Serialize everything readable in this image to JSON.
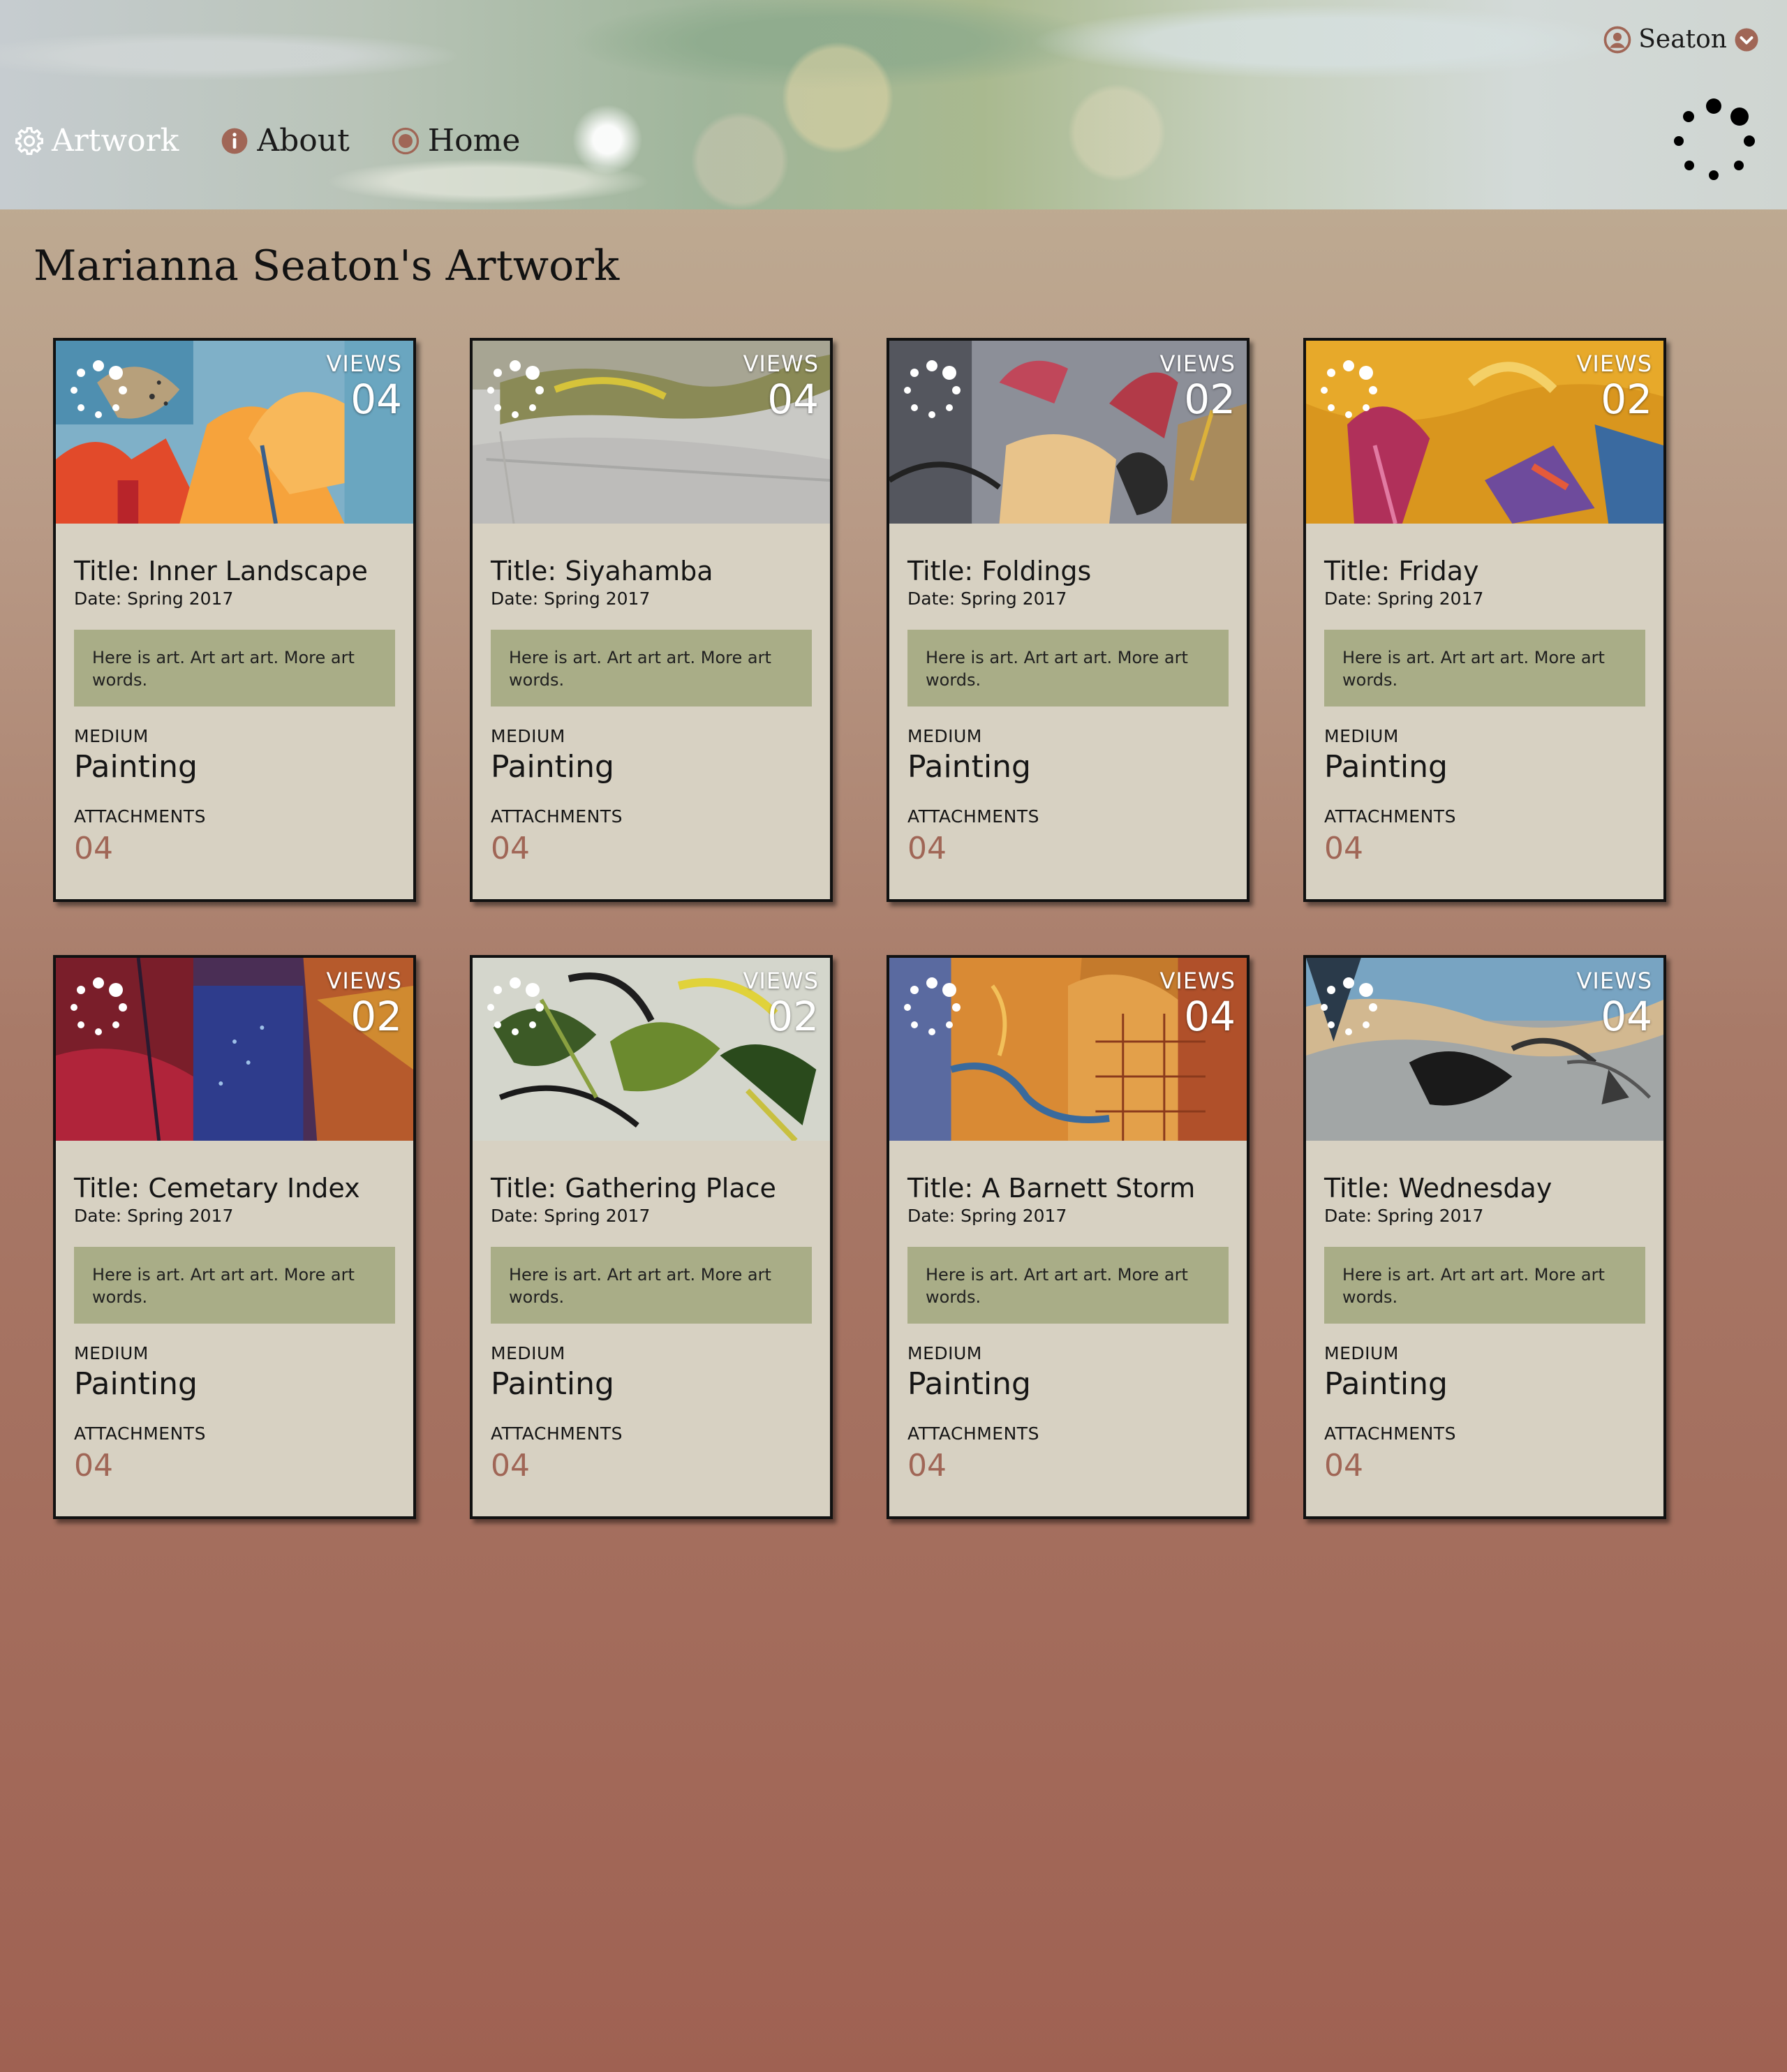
{
  "header": {
    "nav": [
      {
        "label": "Artwork",
        "icon": "gear-icon",
        "active": true
      },
      {
        "label": "About",
        "icon": "info-icon",
        "active": false
      },
      {
        "label": "Home",
        "icon": "record-icon",
        "active": false
      }
    ],
    "user": {
      "name": "Seaton",
      "icon": "user-circle-icon",
      "chevron": "chevron-down-circle-icon"
    }
  },
  "page_title": "Marianna Seaton's Artwork",
  "colors": {
    "accent": "#a06656",
    "description_bg": "#a9ad87",
    "card_bg": "#d7d1c2"
  },
  "cards": [
    {
      "views_label": "VIEWS",
      "views": "04",
      "title": "Title: Inner Landscape",
      "date": "Date: Spring 2017",
      "description": "Here is art. Art art art. More art words.",
      "medium_label": "MEDIUM",
      "medium": "Painting",
      "attachments_label": "ATTACHMENTS",
      "attachments": "04"
    },
    {
      "views_label": "VIEWS",
      "views": "04",
      "title": "Title: Siyahamba",
      "date": "Date: Spring 2017",
      "description": "Here is art. Art art art. More art words.",
      "medium_label": "MEDIUM",
      "medium": "Painting",
      "attachments_label": "ATTACHMENTS",
      "attachments": "04"
    },
    {
      "views_label": "VIEWS",
      "views": "02",
      "title": "Title: Foldings",
      "date": "Date: Spring 2017",
      "description": "Here is art. Art art art. More art words.",
      "medium_label": "MEDIUM",
      "medium": "Painting",
      "attachments_label": "ATTACHMENTS",
      "attachments": "04"
    },
    {
      "views_label": "VIEWS",
      "views": "02",
      "title": "Title: Friday",
      "date": "Date: Spring 2017",
      "description": "Here is art. Art art art. More art words.",
      "medium_label": "MEDIUM",
      "medium": "Painting",
      "attachments_label": "ATTACHMENTS",
      "attachments": "04"
    },
    {
      "views_label": "VIEWS",
      "views": "02",
      "title": "Title: Cemetary Index",
      "date": "Date: Spring 2017",
      "description": "Here is art. Art art art. More art words.",
      "medium_label": "MEDIUM",
      "medium": "Painting",
      "attachments_label": "ATTACHMENTS",
      "attachments": "04"
    },
    {
      "views_label": "VIEWS",
      "views": "02",
      "title": "Title: Gathering Place",
      "date": "Date: Spring 2017",
      "description": "Here is art. Art art art. More art words.",
      "medium_label": "MEDIUM",
      "medium": "Painting",
      "attachments_label": "ATTACHMENTS",
      "attachments": "04"
    },
    {
      "views_label": "VIEWS",
      "views": "04",
      "title": "Title: A Barnett Storm",
      "date": "Date: Spring 2017",
      "description": "Here is art. Art art art. More art words.",
      "medium_label": "MEDIUM",
      "medium": "Painting",
      "attachments_label": "ATTACHMENTS",
      "attachments": "04"
    },
    {
      "views_label": "VIEWS",
      "views": "04",
      "title": "Title: Wednesday",
      "date": "Date: Spring 2017",
      "description": "Here is art. Art art art. More art words.",
      "medium_label": "MEDIUM",
      "medium": "Painting",
      "attachments_label": "ATTACHMENTS",
      "attachments": "04"
    }
  ]
}
